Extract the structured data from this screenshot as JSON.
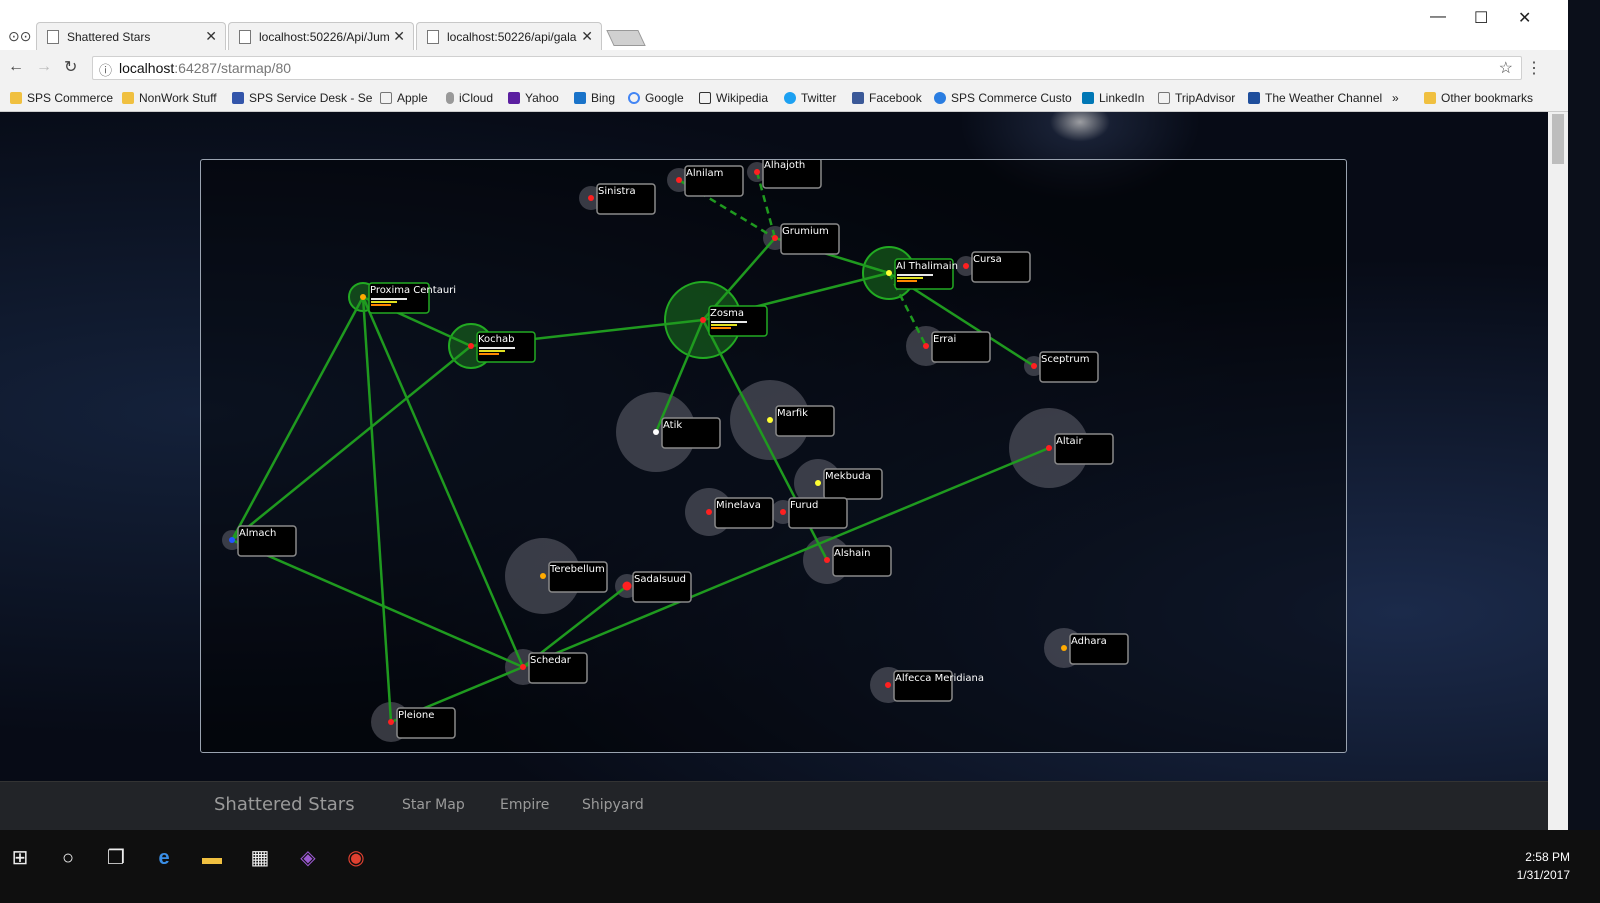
{
  "browser": {
    "tabs": [
      {
        "title": "Shattered Stars",
        "active": true
      },
      {
        "title": "localhost:50226/Api/Jum",
        "active": false
      },
      {
        "title": "localhost:50226/api/gala",
        "active": false
      }
    ],
    "url_host": "localhost",
    "url_rest": ":64287/starmap/80",
    "bookmarks": [
      {
        "label": "SPS Commerce",
        "icon": "folder-icon"
      },
      {
        "label": "NonWork Stuff",
        "icon": "folder-icon"
      },
      {
        "label": "SPS Service Desk - Se",
        "icon": "service-desk-icon"
      },
      {
        "label": "Apple",
        "icon": "page-icon"
      },
      {
        "label": "iCloud",
        "icon": "apple-icon"
      },
      {
        "label": "Yahoo",
        "icon": "yahoo-icon"
      },
      {
        "label": "Bing",
        "icon": "bing-icon"
      },
      {
        "label": "Google",
        "icon": "google-icon"
      },
      {
        "label": "Wikipedia",
        "icon": "wikipedia-icon"
      },
      {
        "label": "Twitter",
        "icon": "twitter-icon"
      },
      {
        "label": "Facebook",
        "icon": "facebook-icon"
      },
      {
        "label": "SPS Commerce Custo",
        "icon": "sps-icon"
      },
      {
        "label": "LinkedIn",
        "icon": "linkedin-icon"
      },
      {
        "label": "TripAdvisor",
        "icon": "page-icon"
      },
      {
        "label": "The Weather Channel",
        "icon": "weather-icon"
      },
      {
        "label": "»",
        "icon": ""
      },
      {
        "label": "Other bookmarks",
        "icon": "folder-icon"
      }
    ]
  },
  "app": {
    "brand": "Shattered Stars",
    "nav": [
      "Star Map",
      "Empire",
      "Shipyard"
    ]
  },
  "starmap": {
    "stars": [
      {
        "name": "Sinistra",
        "color": "#ff2020"
      },
      {
        "name": "Alnilam",
        "color": "#ff2020"
      },
      {
        "name": "Alhajoth",
        "color": "#ff2020"
      },
      {
        "name": "Grumium",
        "color": "#ff2020"
      },
      {
        "name": "Al Thalimain",
        "color": "#ffff33"
      },
      {
        "name": "Cursa",
        "color": "#ff2020"
      },
      {
        "name": "Proxima Centauri",
        "color": "#ffaa00"
      },
      {
        "name": "Kochab",
        "color": "#ff2020"
      },
      {
        "name": "Zosma",
        "color": "#ff2020"
      },
      {
        "name": "Errai",
        "color": "#ff2020"
      },
      {
        "name": "Sceptrum",
        "color": "#ff2020"
      },
      {
        "name": "Atik",
        "color": "#ffffff"
      },
      {
        "name": "Marfik",
        "color": "#ffff33"
      },
      {
        "name": "Altair",
        "color": "#ff2020"
      },
      {
        "name": "Mekbuda",
        "color": "#ffff33"
      },
      {
        "name": "Minelava",
        "color": "#ff2020"
      },
      {
        "name": "Furud",
        "color": "#ff2020"
      },
      {
        "name": "Almach",
        "color": "#2255ff"
      },
      {
        "name": "Alshain",
        "color": "#ff2020"
      },
      {
        "name": "Terebellum",
        "color": "#ffaa00"
      },
      {
        "name": "Sadalsuud",
        "color": "#ff2020"
      },
      {
        "name": "Adhara",
        "color": "#ffaa00"
      },
      {
        "name": "Schedar",
        "color": "#ff2020"
      },
      {
        "name": "Alfecca Meridiana",
        "color": "#ff2020"
      },
      {
        "name": "Pleione",
        "color": "#ff2020"
      }
    ],
    "lanes": [
      [
        "Proxima Centauri",
        "Almach"
      ],
      [
        "Proxima Centauri",
        "Pleione"
      ],
      [
        "Proxima Centauri",
        "Schedar"
      ],
      [
        "Proxima Centauri",
        "Kochab"
      ],
      [
        "Kochab",
        "Almach"
      ],
      [
        "Kochab",
        "Zosma"
      ],
      [
        "Zosma",
        "Grumium"
      ],
      [
        "Zosma",
        "Al Thalimain"
      ],
      [
        "Zosma",
        "Atik"
      ],
      [
        "Zosma",
        "Alshain"
      ],
      [
        "Grumium",
        "Al Thalimain"
      ],
      [
        "Al Thalimain",
        "Sceptrum"
      ],
      [
        "Almach",
        "Schedar"
      ],
      [
        "Pleione",
        "Schedar"
      ],
      [
        "Schedar",
        "Sadalsuud"
      ],
      [
        "Schedar",
        "Altair"
      ]
    ],
    "dashed_lanes": [
      [
        "Alnilam",
        "Grumium"
      ],
      [
        "Alhajoth",
        "Grumium"
      ],
      [
        "Al Thalimain",
        "Errai"
      ]
    ],
    "owned": [
      "Proxima Centauri",
      "Kochab",
      "Zosma",
      "Al Thalimain"
    ],
    "colors": {
      "lane": "#1f9a1f",
      "accent": "#22aa22",
      "bar_white": "#e8e8e8",
      "bar_yellow": "#e0e020",
      "bar_orange": "#ff8800"
    }
  },
  "taskbar": {
    "icons": [
      "windows-start-icon",
      "cortana-icon",
      "task-view-icon",
      "edge-icon",
      "file-explorer-icon",
      "store-icon",
      "visual-studio-icon",
      "chrome-icon"
    ],
    "time": "2:58 PM",
    "date": "1/31/2017"
  }
}
